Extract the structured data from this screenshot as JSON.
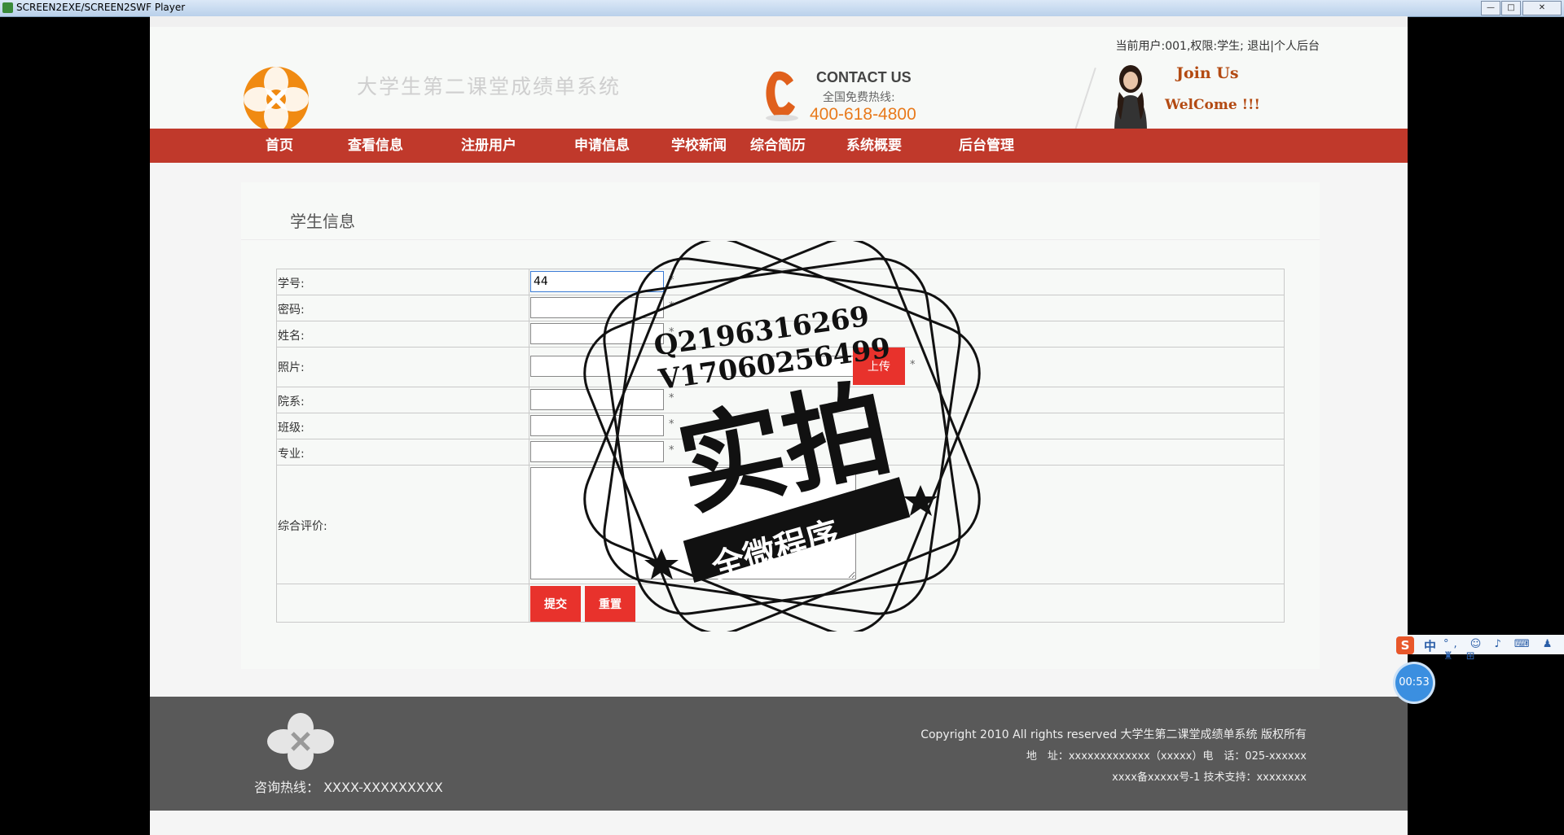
{
  "window": {
    "title": "SCREEN2EXE/SCREEN2SWF Player",
    "min": "—",
    "max": "□",
    "close": "✕"
  },
  "header": {
    "user_info": "当前用户:001,权限:学生; 退出|个人后台",
    "site_title": "大学生第二课堂成绩单系统",
    "contact_title": "CONTACT US",
    "hotline_label": "全国免费热线:",
    "hotline_number": "400-618-4800",
    "join_us": "Join Us",
    "welcome": "WelCome !!!"
  },
  "nav": [
    "首页",
    "查看信息",
    "注册用户",
    "申请信息",
    "学校新闻",
    "综合简历",
    "系统概要",
    "后台管理"
  ],
  "form": {
    "title": "学生信息",
    "required_mark": "*",
    "fields": {
      "student_id": {
        "label": "学号:",
        "value": "44"
      },
      "password": {
        "label": "密码:",
        "value": ""
      },
      "name": {
        "label": "姓名:",
        "value": ""
      },
      "photo": {
        "label": "照片:",
        "value": "",
        "upload_label": "上传"
      },
      "department": {
        "label": "院系:",
        "value": ""
      },
      "class": {
        "label": "班级:",
        "value": ""
      },
      "major": {
        "label": "专业:",
        "value": ""
      },
      "evaluation": {
        "label": "综合评价:",
        "value": ""
      }
    },
    "submit_label": "提交",
    "reset_label": "重置"
  },
  "footer": {
    "hotline": "咨询热线： XXXX-XXXXXXXXX",
    "copyright": "Copyright 2010 All rights reserved 大学生第二课堂成绩单系统 版权所有",
    "address": "地　址：xxxxxxxxxxxxx（xxxxx）电　话：025-xxxxxx",
    "icp": "xxxx备xxxxx号-1 技术支持：xxxxxxxx"
  },
  "watermark": {
    "qq": "Q2196316269",
    "v": "V17060256499",
    "main": "实拍",
    "banner": "全微程序"
  },
  "ime": {
    "logo": "S",
    "mode": "中",
    "icons": "°, ☺ ♪ ⌨ ♟ ♜ ⊞"
  },
  "timer": "00:53",
  "colors": {
    "nav_red": "#c0392b",
    "button_red": "#e8322c",
    "hotline_orange": "#e87a1c",
    "footer_gray": "#595959"
  }
}
